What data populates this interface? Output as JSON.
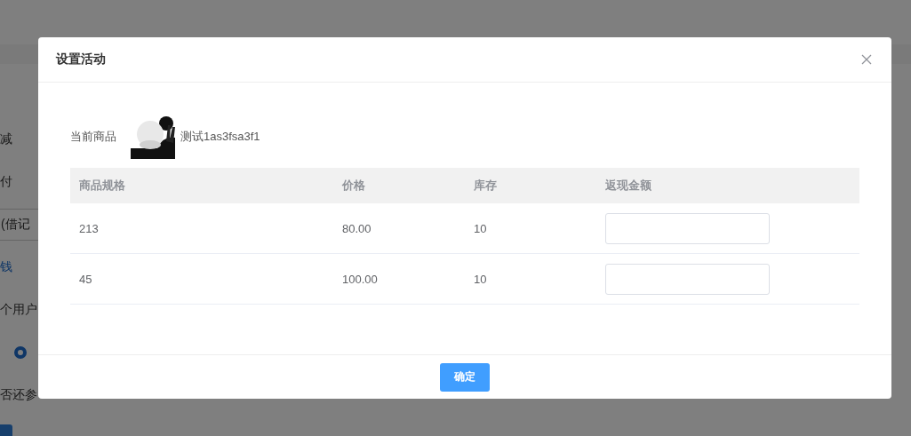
{
  "background_page": {
    "items": [
      {
        "kind": "text",
        "text": "减"
      },
      {
        "kind": "text",
        "text": "付"
      },
      {
        "kind": "field",
        "text": "(借记"
      },
      {
        "kind": "link",
        "text": "钱"
      },
      {
        "kind": "text",
        "text": "个用户"
      },
      {
        "kind": "radio",
        "selected": true
      },
      {
        "kind": "text",
        "text": "否还参"
      },
      {
        "kind": "button"
      }
    ]
  },
  "dialog": {
    "title": "设置活动",
    "product": {
      "label": "当前商品",
      "name": "测试1as3fsa3f1"
    },
    "table": {
      "columns": [
        "商品规格",
        "价格",
        "库存",
        "返现金额"
      ],
      "rows": [
        {
          "spec": "213",
          "price": "80.00",
          "stock": "10",
          "cashback": ""
        },
        {
          "spec": "45",
          "price": "100.00",
          "stock": "10",
          "cashback": ""
        }
      ]
    },
    "confirm_button": "确定"
  }
}
